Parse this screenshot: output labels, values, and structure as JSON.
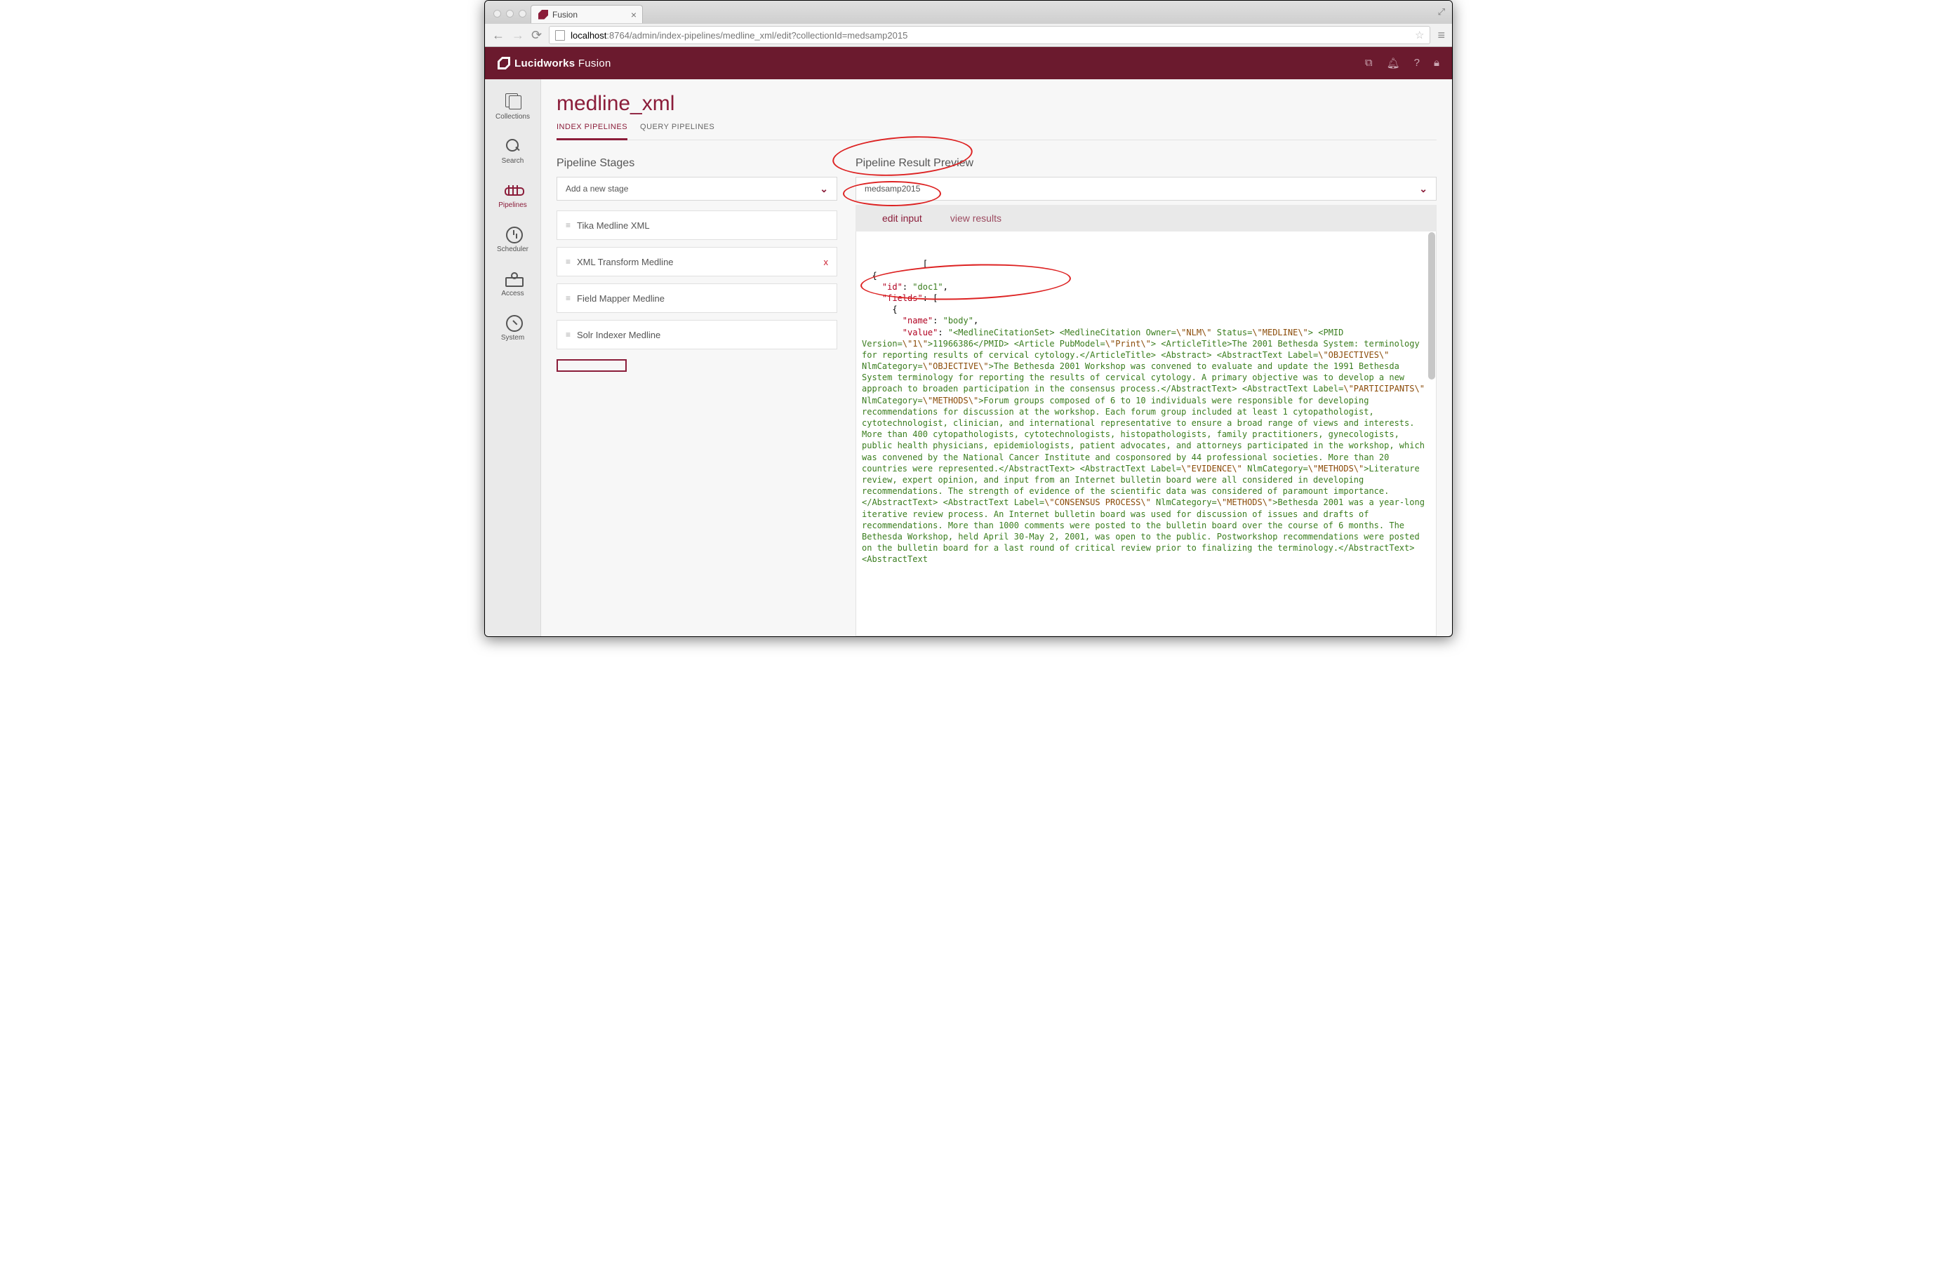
{
  "browser": {
    "tab_title": "Fusion",
    "url_host": "localhost",
    "url_path": ":8764/admin/index-pipelines/medline_xml/edit?collectionId=medsamp2015"
  },
  "brand": {
    "company": "Lucidworks",
    "product": "Fusion"
  },
  "sidebar": {
    "items": [
      {
        "label": "Collections"
      },
      {
        "label": "Search"
      },
      {
        "label": "Pipelines"
      },
      {
        "label": "Scheduler"
      },
      {
        "label": "Access"
      },
      {
        "label": "System"
      }
    ],
    "active_index": 2
  },
  "page": {
    "title": "medline_xml",
    "tabs": [
      {
        "label": "INDEX PIPELINES",
        "active": true
      },
      {
        "label": "QUERY PIPELINES",
        "active": false
      }
    ]
  },
  "pipeline_stages": {
    "heading": "Pipeline Stages",
    "add_placeholder": "Add a new stage",
    "stages": [
      {
        "label": "Tika Medline XML",
        "removable": false
      },
      {
        "label": "XML Transform Medline",
        "removable": true
      },
      {
        "label": "Field Mapper Medline",
        "removable": false
      },
      {
        "label": "Solr Indexer Medline",
        "removable": false
      }
    ]
  },
  "preview": {
    "heading": "Pipeline Result Preview",
    "collection": "medsamp2015",
    "tabs": [
      {
        "label": "edit input",
        "active": true
      },
      {
        "label": "view results",
        "active": false
      }
    ],
    "json": {
      "open": "[",
      "obj_open": "{",
      "id_key": "\"id\"",
      "id_val": "\"doc1\"",
      "fields_key": "\"fields\"",
      "arr_open": "[",
      "obj2_open": "{",
      "name_key": "\"name\"",
      "name_val": "\"body\"",
      "value_key": "\"value\"",
      "value_text": "\"<MedlineCitationSet> <MedlineCitation Owner=\\\"NLM\\\" Status=\\\"MEDLINE\\\"> <PMID Version=\\\"1\\\">11966386</PMID> <Article PubModel=\\\"Print\\\"> <ArticleTitle>The 2001 Bethesda System: terminology for reporting results of cervical cytology.</ArticleTitle> <Abstract> <AbstractText Label=\\\"OBJECTIVES\\\" NlmCategory=\\\"OBJECTIVE\\\">The Bethesda 2001 Workshop was convened to evaluate and update the 1991 Bethesda System terminology for reporting the results of cervical cytology. A primary objective was to develop a new approach to broaden participation in the consensus process.</AbstractText> <AbstractText Label=\\\"PARTICIPANTS\\\" NlmCategory=\\\"METHODS\\\">Forum groups composed of 6 to 10 individuals were responsible for developing recommendations for discussion at the workshop. Each forum group included at least 1 cytopathologist, cytotechnologist, clinician, and international representative to ensure a broad range of views and interests. More than 400 cytopathologists, cytotechnologists, histopathologists, family practitioners, gynecologists, public health physicians, epidemiologists, patient advocates, and attorneys participated in the workshop, which was convened by the National Cancer Institute and cosponsored by 44 professional societies. More than 20 countries were represented.</AbstractText> <AbstractText Label=\\\"EVIDENCE\\\" NlmCategory=\\\"METHODS\\\">Literature review, expert opinion, and input from an Internet bulletin board were all considered in developing recommendations. The strength of evidence of the scientific data was considered of paramount importance.</AbstractText> <AbstractText Label=\\\"CONSENSUS PROCESS\\\" NlmCategory=\\\"METHODS\\\">Bethesda 2001 was a year-long iterative review process. An Internet bulletin board was used for discussion of issues and drafts of recommendations. More than 1000 comments were posted to the bulletin board over the course of 6 months. The Bethesda Workshop, held April 30-May 2, 2001, was open to the public. Postworkshop recommendations were posted on the bulletin board for a last round of critical review prior to finalizing the terminology.</AbstractText> <AbstractText"
    }
  }
}
